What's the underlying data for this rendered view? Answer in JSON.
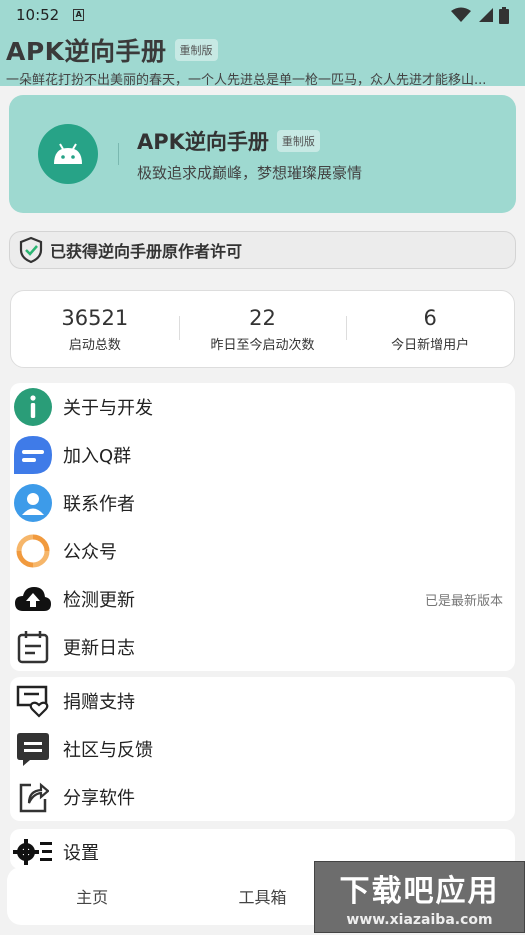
{
  "status_bar": {
    "time": "10:52",
    "a_icon_letter": "A"
  },
  "header": {
    "title": "APK逆向手册",
    "badge": "重制版",
    "marquee": "一朵鲜花打扮不出美丽的春天，一个人先进总是单一枪一匹马，众人先进才能移山..."
  },
  "hero": {
    "title": "APK逆向手册",
    "badge": "重制版",
    "subtitle": "极致追求成巅峰，梦想璀璨展豪情"
  },
  "permit": {
    "text": "已获得逆向手册原作者许可"
  },
  "stats": [
    {
      "value": "36521",
      "label": "启动总数"
    },
    {
      "value": "22",
      "label": "昨日至今启动次数"
    },
    {
      "value": "6",
      "label": "今日新增用户"
    }
  ],
  "menu_group_1": {
    "about": "关于与开发",
    "qq_group": "加入Q群",
    "contact": "联系作者",
    "wechat": "公众号",
    "update": "检测更新",
    "update_note": "已是最新版本",
    "changelog": "更新日志"
  },
  "menu_group_2": {
    "donate": "捐赠支持",
    "community": "社区与反馈",
    "share": "分享软件"
  },
  "menu_group_3": {
    "settings": "设置"
  },
  "bottom_nav": {
    "home": "主页",
    "tools": "工具箱"
  },
  "watermark": {
    "big": "下载吧应用",
    "small": "www.xiazaiba.com"
  }
}
